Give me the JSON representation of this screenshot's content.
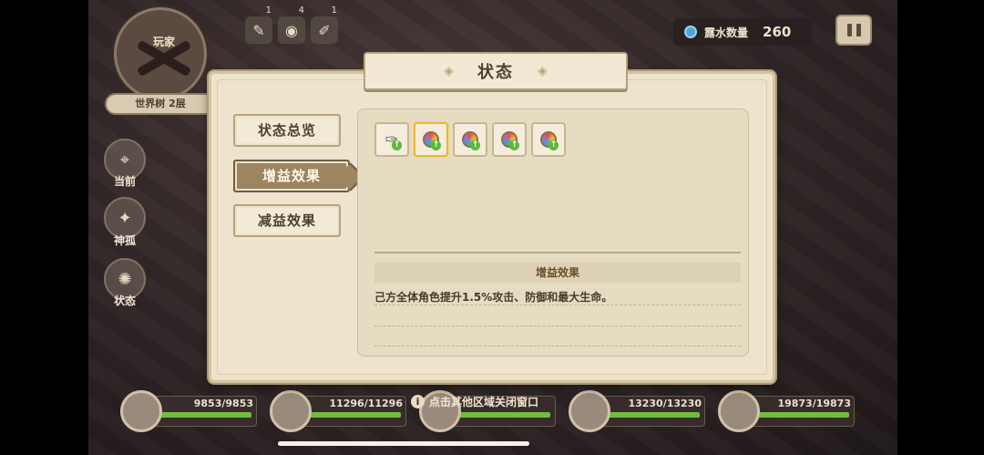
{
  "hud": {
    "minimap_player_label": "玩家",
    "map_location": "世界树 2层",
    "side_buttons": [
      {
        "label": "当前",
        "icon": "map-pin-icon"
      },
      {
        "label": "神孤",
        "icon": "compass-icon"
      },
      {
        "label": "状态",
        "icon": "status-icon"
      }
    ],
    "top_items": [
      {
        "icon": "feather-icon",
        "count": "1"
      },
      {
        "icon": "orb-icon",
        "count": "4"
      },
      {
        "icon": "wing-icon",
        "count": "1"
      }
    ],
    "dew_label": "露水数量",
    "dew_value": "260"
  },
  "modal": {
    "title": "状态",
    "tabs": [
      {
        "label": "状态总览",
        "active": false
      },
      {
        "label": "增益效果",
        "active": true
      },
      {
        "label": "减益效果",
        "active": false
      }
    ],
    "buff_icons": [
      "feather-buff-icon",
      "orb-buff-icon",
      "orb-buff-icon",
      "orb-buff-icon",
      "orb-buff-icon"
    ],
    "selected_buff_index": 1,
    "description_heading": "增益效果",
    "description_text": "己方全体角色提升1.5%攻击、防御和最大生命。"
  },
  "hint_text": "点击其他区域关闭窗口",
  "party": [
    {
      "hp_text": "9853/9853",
      "hp_fraction": 1.0
    },
    {
      "hp_text": "11296/11296",
      "hp_fraction": 1.0
    },
    {
      "hp_text": "",
      "hp_fraction": 1.0
    },
    {
      "hp_text": "13230/13230",
      "hp_fraction": 1.0
    },
    {
      "hp_text": "19873/19873",
      "hp_fraction": 1.0
    }
  ]
}
